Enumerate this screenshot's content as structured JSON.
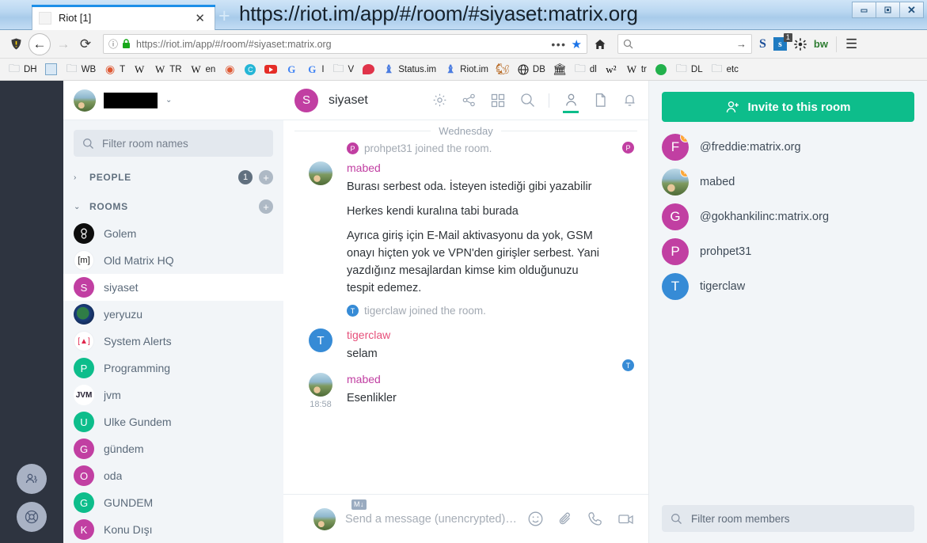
{
  "window": {
    "title_url": "https://riot.im/app/#/room/#siyaset:matrix.org",
    "minimize_label": "▭",
    "maximize_label": "❐",
    "close_label": "✕"
  },
  "tabs": {
    "active": {
      "title": "Riot [1]",
      "close_label": "✕"
    },
    "new_tab_label": "+"
  },
  "toolbar": {
    "back_label": "←",
    "forward_label": "→",
    "reload_label": "⟳",
    "url": "https://riot.im/app/#/room/#siyaset:matrix.org",
    "url_info_icon": "info-icon",
    "url_lock_icon": "lock-icon",
    "page_actions_label": "•••",
    "bookmark_star_label": "★",
    "home_label": "home-icon",
    "search_placeholder": "",
    "search_go_label": "→",
    "extensions": [
      {
        "name": "skype-extension",
        "label": "S"
      },
      {
        "name": "skype-badge-extension",
        "label": "s",
        "badge": "1"
      },
      {
        "name": "settings-extension",
        "label": "gear-icon"
      },
      {
        "name": "bitwarden-extension",
        "label": "bw"
      }
    ],
    "menu_label": "☰"
  },
  "bookmarks": [
    {
      "icon": "folder-icon",
      "label": "DH"
    },
    {
      "icon": "app-icon",
      "label": ""
    },
    {
      "icon": "folder-icon",
      "label": "WB"
    },
    {
      "icon": "duckduckgo-icon",
      "label": "T"
    },
    {
      "icon": "wikipedia-icon",
      "label": ""
    },
    {
      "icon": "wikipedia-icon",
      "label": "TR"
    },
    {
      "icon": "wikipedia-icon",
      "label": "en"
    },
    {
      "icon": "duckduckgo-icon",
      "label": ""
    },
    {
      "icon": "cyan-app-icon",
      "label": ""
    },
    {
      "icon": "youtube-icon",
      "label": ""
    },
    {
      "icon": "google-icon",
      "label": ""
    },
    {
      "icon": "google-icon",
      "label": "I"
    },
    {
      "icon": "folder-icon",
      "label": "V"
    },
    {
      "icon": "chat-icon",
      "label": ""
    },
    {
      "icon": "status-icon",
      "label": "Status.im"
    },
    {
      "icon": "riot-icon",
      "label": "Riot.im"
    },
    {
      "icon": "squirrel-icon",
      "label": ""
    },
    {
      "icon": "globe-icon",
      "label": "DB"
    },
    {
      "icon": "bank-icon",
      "label": ""
    },
    {
      "icon": "folder-icon",
      "label": "dl"
    },
    {
      "icon": "w2-icon",
      "label": ""
    },
    {
      "icon": "wikipedia-icon",
      "label": "tr"
    },
    {
      "icon": "green-dot-icon",
      "label": ""
    },
    {
      "icon": "folder-icon",
      "label": "DL"
    },
    {
      "icon": "folder-icon",
      "label": "etc"
    }
  ],
  "groupstrip": {
    "buttons": [
      {
        "name": "group-people-button",
        "icon": "people-icon"
      },
      {
        "name": "group-settings-button",
        "icon": "lifebuoy-icon"
      }
    ]
  },
  "sidebar": {
    "user": {
      "name_redacted": true,
      "chevron": "⌄",
      "avatar": "user-avatar"
    },
    "filter": {
      "placeholder": "Filter room names",
      "icon": "search-icon"
    },
    "sections": [
      {
        "label": "PEOPLE",
        "expanded": false,
        "chevron": "›",
        "badge": "1",
        "add_label": "+"
      },
      {
        "label": "ROOMS",
        "expanded": true,
        "chevron": "⌄",
        "badge": "",
        "add_label": "+"
      }
    ],
    "rooms": [
      {
        "name": "Golem",
        "initial": "",
        "color": "#111111",
        "avatar_type": "image",
        "selected": false
      },
      {
        "name": "Old Matrix HQ",
        "initial": "m",
        "color": "#ffffff",
        "avatar_type": "matrix",
        "selected": false
      },
      {
        "name": "siyaset",
        "initial": "S",
        "color": "#c13fa2",
        "avatar_type": "letter",
        "selected": true
      },
      {
        "name": "yeryuzu",
        "initial": "",
        "color": "#1b1f4a",
        "avatar_type": "image",
        "selected": false
      },
      {
        "name": "System Alerts",
        "initial": "▲",
        "color": "#ffffff",
        "avatar_type": "alert",
        "selected": false
      },
      {
        "name": "Programming",
        "initial": "P",
        "color": "#0dbd8b",
        "avatar_type": "letter",
        "selected": false
      },
      {
        "name": "jvm",
        "initial": "JVM",
        "color": "#ffffff",
        "avatar_type": "jvm",
        "selected": false
      },
      {
        "name": "Ulke Gundem",
        "initial": "U",
        "color": "#0dbd8b",
        "avatar_type": "letter",
        "selected": false
      },
      {
        "name": "gündem",
        "initial": "G",
        "color": "#c13fa2",
        "avatar_type": "letter",
        "selected": false
      },
      {
        "name": "oda",
        "initial": "O",
        "color": "#c13fa2",
        "avatar_type": "letter",
        "selected": false
      },
      {
        "name": "GUNDEM",
        "initial": "G",
        "color": "#0dbd8b",
        "avatar_type": "letter",
        "selected": false
      },
      {
        "name": "Konu Dışı",
        "initial": "K",
        "color": "#c13fa2",
        "avatar_type": "letter",
        "selected": false
      }
    ]
  },
  "room": {
    "name": "siyaset",
    "avatar_initial": "S",
    "avatar_color": "#c13fa2",
    "header_icons": [
      {
        "name": "settings-icon",
        "glyph": "gear"
      },
      {
        "name": "share-icon",
        "glyph": "share"
      },
      {
        "name": "apps-icon",
        "glyph": "grid"
      },
      {
        "name": "search-icon",
        "glyph": "search"
      },
      {
        "name": "members-icon",
        "glyph": "person",
        "active": true
      },
      {
        "name": "files-icon",
        "glyph": "file",
        "active": false
      },
      {
        "name": "notifications-icon",
        "glyph": "bell",
        "active": false
      }
    ]
  },
  "timeline": {
    "day_separator": "Wednesday",
    "events": [
      {
        "type": "system",
        "text": "prohpet31 joined the room.",
        "avatar_initial": "P",
        "avatar_color": "#c13fa2",
        "read_receipt": {
          "initial": "P",
          "color": "#c13fa2"
        }
      },
      {
        "type": "message",
        "sender": "mabed",
        "sender_color": "#c13fa2",
        "avatar_type": "photo",
        "timestamp": "",
        "paragraphs": [
          "Burası serbest oda. İsteyen istediği gibi yazabilir",
          "Herkes kendi kuralına tabi burada",
          "Ayrıca giriş için E-Mail aktivasyonu da yok, GSM onayı hiçten yok ve VPN'den girişler serbest. Yani yazdığınz mesajlardan kimse kim olduğunuzu tespit edemez."
        ]
      },
      {
        "type": "system",
        "text": "tigerclaw joined the room.",
        "avatar_initial": "T",
        "avatar_color": "#368bd6",
        "read_receipt": null
      },
      {
        "type": "message",
        "sender": "tigerclaw",
        "sender_color": "#e64f7a",
        "avatar_type": "letter",
        "avatar_initial": "T",
        "avatar_color": "#368bd6",
        "timestamp": "",
        "paragraphs": [
          "selam"
        ],
        "read_receipt": {
          "initial": "T",
          "color": "#368bd6"
        }
      },
      {
        "type": "message",
        "sender": "mabed",
        "sender_color": "#c13fa2",
        "avatar_type": "photo",
        "timestamp": "18:58",
        "paragraphs": [
          "Esenlikler"
        ]
      }
    ]
  },
  "composer": {
    "markdown_badge": "M↓",
    "placeholder": "Send a message (unencrypted)…",
    "icons": [
      {
        "name": "emoji-icon",
        "glyph": "smiley"
      },
      {
        "name": "attachment-icon",
        "glyph": "paperclip"
      },
      {
        "name": "voice-call-icon",
        "glyph": "phone"
      },
      {
        "name": "video-call-icon",
        "glyph": "video"
      }
    ]
  },
  "member_panel": {
    "invite_label": "Invite to this room",
    "invite_icon": "person-add-icon",
    "invite_color": "#0dbd8b",
    "members": [
      {
        "name": "@freddie:matrix.org",
        "initial": "F",
        "color": "#c13fa2",
        "avatar_type": "letter",
        "power": true
      },
      {
        "name": "mabed",
        "initial": "",
        "color": "#8a9a6c",
        "avatar_type": "photo",
        "power": true
      },
      {
        "name": "@gokhankilinc:matrix.org",
        "initial": "G",
        "color": "#c13fa2",
        "avatar_type": "letter",
        "power": false
      },
      {
        "name": "prohpet31",
        "initial": "P",
        "color": "#c13fa2",
        "avatar_type": "letter",
        "power": false
      },
      {
        "name": "tigerclaw",
        "initial": "T",
        "color": "#368bd6",
        "avatar_type": "letter",
        "power": false
      }
    ],
    "filter": {
      "placeholder": "Filter room members",
      "icon": "search-icon"
    }
  }
}
